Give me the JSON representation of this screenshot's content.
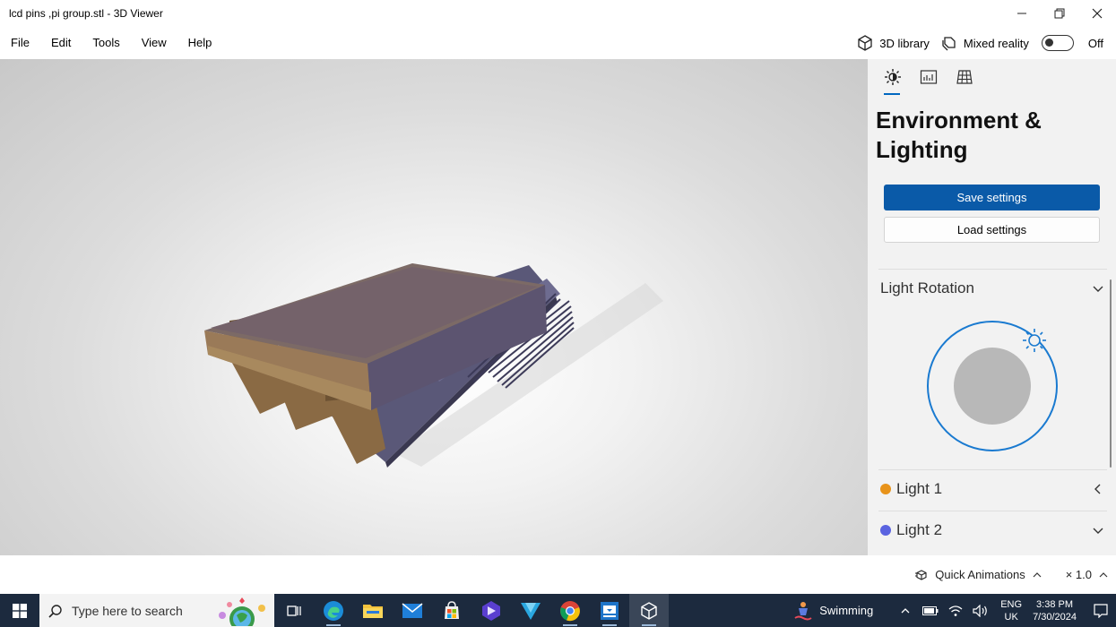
{
  "window": {
    "title": "lcd pins ,pi group.stl - 3D Viewer"
  },
  "menu": {
    "items": [
      "File",
      "Edit",
      "Tools",
      "View",
      "Help"
    ]
  },
  "toolbar": {
    "library_label": "3D library",
    "mixed_reality_label": "Mixed reality",
    "mixed_reality_state": "Off"
  },
  "panel": {
    "title": "Environment & Lighting",
    "save_label": "Save settings",
    "load_label": "Load settings",
    "light_rotation_label": "Light Rotation",
    "lights": [
      {
        "label": "Light 1",
        "color": "#e8931a"
      },
      {
        "label": "Light 2",
        "color": "#5a63e0"
      }
    ],
    "accent_color": "#0a5aa8"
  },
  "statusbar": {
    "quick_animations_label": "Quick Animations",
    "zoom_label": "× 1.0"
  },
  "taskbar": {
    "search_placeholder": "Type here to search",
    "weather": "Swimming",
    "lang_line1": "ENG",
    "lang_line2": "UK",
    "time": "3:38 PM",
    "date": "7/30/2024"
  }
}
